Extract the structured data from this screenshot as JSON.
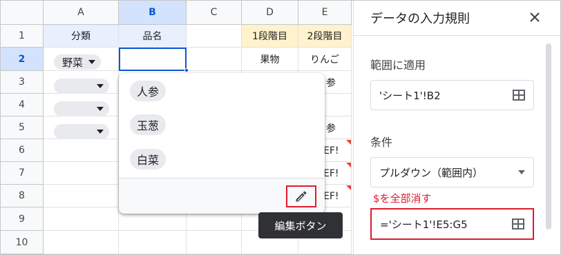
{
  "columns": [
    "A",
    "B",
    "C",
    "D",
    "E"
  ],
  "rows": [
    "1",
    "2",
    "3",
    "4",
    "5",
    "6",
    "7",
    "8",
    "9",
    "10"
  ],
  "cells": {
    "a1": "分類",
    "b1": "品名",
    "d1": "1段階目",
    "e1": "2段階目",
    "a2_chip": "野菜",
    "d2": "果物",
    "e2": "りんご",
    "e3": "参",
    "e5": "参",
    "e6": "EF!",
    "e7": "EF!",
    "e8": "EF!"
  },
  "dropdown": {
    "options": [
      "人参",
      "玉葱",
      "白菜"
    ],
    "edit_icon": "pencil-icon",
    "tooltip": "編集ボタン"
  },
  "panel": {
    "title": "データの入力規則",
    "close_icon": "close-icon",
    "range_label": "範囲に適用",
    "range_value": "'シート1'!B2",
    "condition_label": "条件",
    "condition_value": "プルダウン（範囲内）",
    "clear_dollar": "$を全部消す",
    "source_value": "='シート1'!E5:G5",
    "grid_icon": "grid-select-icon"
  },
  "colors": {
    "header_fill_blue": "#e8f0fe",
    "header_fill_yellow": "#fff2cc",
    "selection": "#0b57d0",
    "annotation_red": "#e0192d"
  }
}
